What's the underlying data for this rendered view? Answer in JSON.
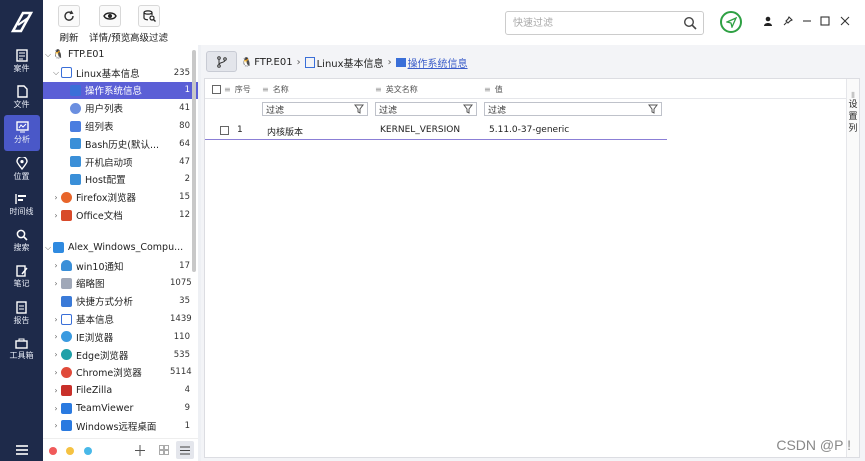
{
  "nav": {
    "items": [
      {
        "label": "案件",
        "icon": "case-icon"
      },
      {
        "label": "文件",
        "icon": "file-icon"
      },
      {
        "label": "分析",
        "icon": "analysis-icon",
        "active": true
      },
      {
        "label": "位置",
        "icon": "location-icon"
      },
      {
        "label": "时间线",
        "icon": "timeline-icon"
      },
      {
        "label": "搜索",
        "icon": "search-icon"
      },
      {
        "label": "笔记",
        "icon": "note-icon"
      },
      {
        "label": "报告",
        "icon": "report-icon"
      },
      {
        "label": "工具箱",
        "icon": "toolbox-icon"
      }
    ]
  },
  "toolbar": {
    "refresh": "刷新",
    "preview": "详情/预览",
    "advanced_filter": "高级过滤",
    "search_placeholder": "快速过滤"
  },
  "tree": {
    "groups": [
      {
        "label": "FTP.E01",
        "children": [
          {
            "label": "Linux基本信息",
            "count": "235",
            "children": [
              {
                "label": "操作系统信息",
                "count": "1",
                "selected": true
              },
              {
                "label": "用户列表",
                "count": "41"
              },
              {
                "label": "组列表",
                "count": "80"
              },
              {
                "label": "Bash历史(默认...",
                "count": "64"
              },
              {
                "label": "开机启动项",
                "count": "47"
              },
              {
                "label": "Host配置",
                "count": "2"
              }
            ]
          },
          {
            "label": "Firefox浏览器",
            "count": "15"
          },
          {
            "label": "Office文档",
            "count": "12"
          }
        ]
      },
      {
        "label": "Alex_Windows_Compu...",
        "children": [
          {
            "label": "win10通知",
            "count": "17"
          },
          {
            "label": "缩略图",
            "count": "1075"
          },
          {
            "label": "快捷方式分析",
            "count": "35"
          },
          {
            "label": "基本信息",
            "count": "1439"
          },
          {
            "label": "IE浏览器",
            "count": "110"
          },
          {
            "label": "Edge浏览器",
            "count": "535"
          },
          {
            "label": "Chrome浏览器",
            "count": "5114"
          },
          {
            "label": "FileZilla",
            "count": "4"
          },
          {
            "label": "TeamViewer",
            "count": "9"
          },
          {
            "label": "Windows远程桌面",
            "count": "1"
          }
        ]
      }
    ]
  },
  "breadcrumb": [
    "FTP.E01",
    "Linux基本信息",
    "操作系统信息"
  ],
  "grid": {
    "columns": [
      "序号",
      "名称",
      "英文名称",
      "值"
    ],
    "filter_placeholder": "过滤",
    "rows": [
      {
        "index": "1",
        "name": "内核版本",
        "en_name": "KERNEL_VERSION",
        "value": "5.11.0-37-generic"
      }
    ],
    "side_label": [
      "设",
      "置",
      "列"
    ]
  },
  "watermark": "CSDN @P ! ",
  "colors": {
    "nav_bg": "#1e2a4a",
    "nav_active": "#4a58c8",
    "tree_selected": "#5b5fd6",
    "send_green": "#2ea043",
    "link_blue": "#3a5cc9"
  }
}
